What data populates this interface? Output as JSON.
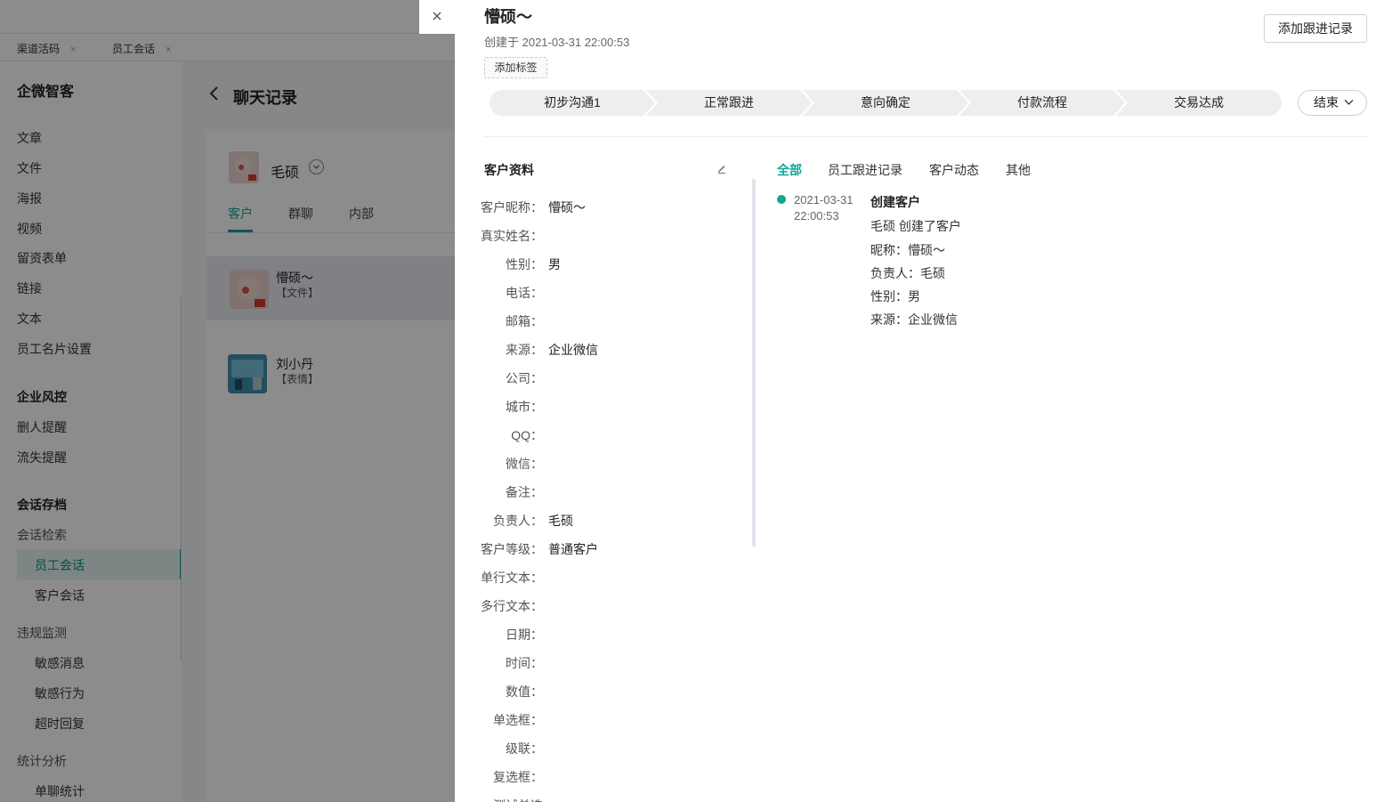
{
  "tabs": [
    {
      "label": "渠道活码",
      "close": "×"
    },
    {
      "label": "员工会话",
      "close": "×"
    }
  ],
  "sidebar": {
    "brand": "企微智客",
    "items": [
      "文章",
      "文件",
      "海报",
      "视频",
      "留资表单",
      "链接",
      "文本",
      "员工名片设置"
    ],
    "risk_group": "企业风控",
    "risk_items": [
      "删人提醒",
      "流失提醒"
    ],
    "archive_group": "会话存档",
    "search_group": "会话检索",
    "search_items": [
      "员工会话",
      "客户会话"
    ],
    "monitor_group": "违规监测",
    "monitor_items": [
      "敏感消息",
      "敏感行为",
      "超时回复"
    ],
    "stats_group": "统计分析",
    "stats_items": [
      "单聊统计"
    ]
  },
  "main": {
    "title": "聊天记录",
    "user_name": "毛硕",
    "subtabs": [
      "客户",
      "群聊",
      "内部"
    ],
    "chats": [
      {
        "name": "懵硕～",
        "preview": "【文件】"
      },
      {
        "name": "刘小丹",
        "preview": "【表情】"
      }
    ]
  },
  "drawer": {
    "close": "×",
    "title": "懵硕～",
    "created": "创建于 2021-03-31 22:00:53",
    "add_tag": "添加标签",
    "add_follow": "添加跟进记录",
    "stages": [
      "初步沟通1",
      "正常跟进",
      "意向确定",
      "付款流程",
      "交易达成"
    ],
    "end_label": "结束",
    "profile": {
      "title": "客户资料",
      "fields": [
        {
          "label": "客户昵称：",
          "value": "懵硕～"
        },
        {
          "label": "真实姓名：",
          "value": ""
        },
        {
          "label": "性别：",
          "value": "男"
        },
        {
          "label": "电话：",
          "value": ""
        },
        {
          "label": "邮箱：",
          "value": ""
        },
        {
          "label": "来源：",
          "value": "企业微信"
        },
        {
          "label": "公司：",
          "value": ""
        },
        {
          "label": "城市：",
          "value": ""
        },
        {
          "label": "QQ：",
          "value": ""
        },
        {
          "label": "微信：",
          "value": ""
        },
        {
          "label": "备注：",
          "value": ""
        },
        {
          "label": "负责人：",
          "value": "毛硕"
        },
        {
          "label": "客户等级：",
          "value": "普通客户"
        },
        {
          "label": "单行文本：",
          "value": ""
        },
        {
          "label": "多行文本：",
          "value": ""
        },
        {
          "label": "日期：",
          "value": ""
        },
        {
          "label": "时间：",
          "value": ""
        },
        {
          "label": "数值：",
          "value": ""
        },
        {
          "label": "单选框：",
          "value": ""
        },
        {
          "label": "级联：",
          "value": ""
        },
        {
          "label": "复选框：",
          "value": ""
        },
        {
          "label": "测试单选",
          "value": ""
        }
      ]
    },
    "record_tabs": [
      "全部",
      "员工跟进记录",
      "客户动态",
      "其他"
    ],
    "timeline": {
      "date": "2021-03-31",
      "time": "22:00:53",
      "title": "创建客户",
      "lines": [
        "毛硕 创建了客户",
        "昵称：懵硕～",
        "负责人：毛硕",
        "性别：男",
        "来源：企业微信"
      ]
    },
    "colors": {
      "accent": "#12a594"
    }
  }
}
